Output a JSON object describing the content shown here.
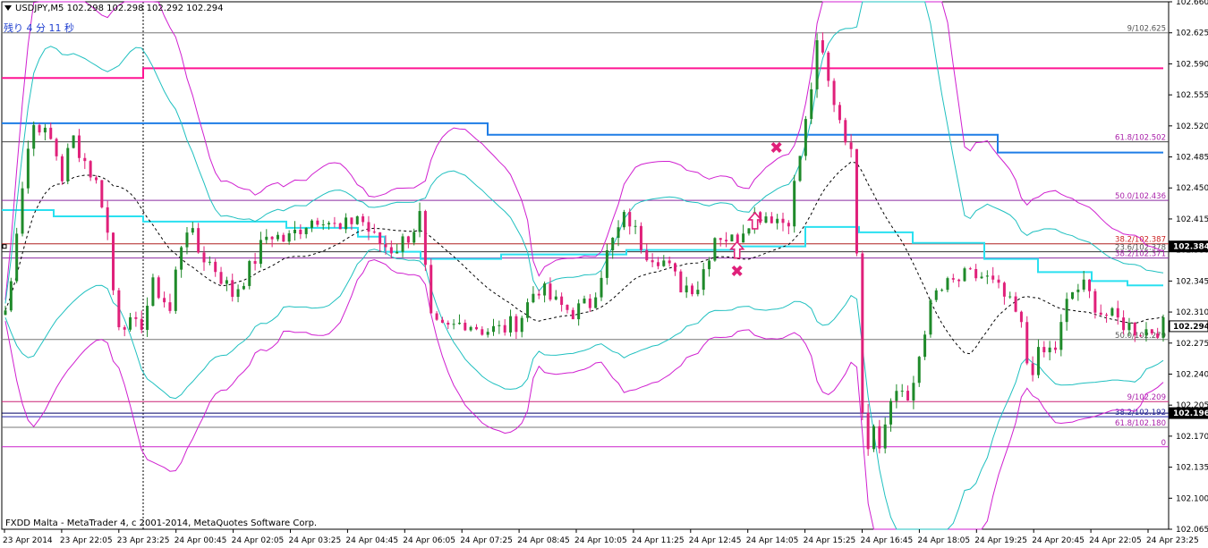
{
  "header": {
    "dropdown_icon": "triangle-down",
    "symbol_line": "USDJPY,M5  102.298 102.298 102.292 102.294",
    "timer": "残り 4 分 11 秒"
  },
  "footer": {
    "copyright": "FXDD Malta - MetaTrader 4, c 2001-2014, MetaQuotes Software Corp."
  },
  "chart_data": {
    "type": "candlestick",
    "symbol": "USDJPY",
    "timeframe": "M5",
    "ylim": [
      102.065,
      102.66
    ],
    "y_ticks": [
      "102.660",
      "102.625",
      "102.590",
      "102.555",
      "102.520",
      "102.485",
      "102.450",
      "102.415",
      "102.380",
      "102.345",
      "102.310",
      "102.275",
      "102.240",
      "102.205",
      "102.170",
      "102.135",
      "102.100",
      "102.065"
    ],
    "x_ticks": [
      "23 Apr 2014",
      "23 Apr 22:05",
      "23 Apr 23:25",
      "24 Apr 00:45",
      "24 Apr 02:05",
      "24 Apr 03:25",
      "24 Apr 04:45",
      "24 Apr 06:05",
      "24 Apr 07:25",
      "24 Apr 08:45",
      "24 Apr 10:05",
      "24 Apr 11:25",
      "24 Apr 12:45",
      "24 Apr 14:05",
      "24 Apr 15:25",
      "24 Apr 16:45",
      "24 Apr 18:05",
      "24 Apr 19:25",
      "24 Apr 20:45",
      "24 Apr 22:05",
      "24 Apr 23:25"
    ],
    "current_price": "102.294",
    "price_tags": [
      {
        "value": 102.384,
        "label": "102.384"
      },
      {
        "value": 102.294,
        "label": "102.294"
      },
      {
        "value": 102.196,
        "label": "102.196"
      }
    ],
    "fib_levels": [
      {
        "value": 102.625,
        "label": "9/102.625",
        "color": "#555555"
      },
      {
        "value": 102.502,
        "label": "61.8/102.502",
        "color": "#aa22aa"
      },
      {
        "value": 102.436,
        "label": "50.0/102.436",
        "color": "#aa22aa"
      },
      {
        "value": 102.387,
        "label": "38.2/102.387",
        "color": "#cc2222"
      },
      {
        "value": 102.378,
        "label": "23.6/102.378",
        "color": "#555555"
      },
      {
        "value": 102.371,
        "label": "38.2/102.371",
        "color": "#aa22aa"
      },
      {
        "value": 102.279,
        "label": "50.0/102.279",
        "color": "#555555"
      },
      {
        "value": 102.209,
        "label": "9/102.209",
        "color": "#aa22aa"
      },
      {
        "value": 102.192,
        "label": "38.2/102.192",
        "color": "#222299"
      },
      {
        "value": 102.18,
        "label": "61.8/102.180",
        "color": "#aa22aa"
      },
      {
        "value": 102.158,
        "label": "0",
        "color": "#aa22aa"
      }
    ],
    "horizontal_lines": [
      {
        "value": 102.625,
        "color": "#777777"
      },
      {
        "value": 102.502,
        "color": "#444444"
      },
      {
        "value": 102.436,
        "color": "#8a2aa0"
      },
      {
        "value": 102.387,
        "color": "#b02020"
      },
      {
        "value": 102.378,
        "color": "#333333"
      },
      {
        "value": 102.371,
        "color": "#8a2aa0"
      },
      {
        "value": 102.279,
        "color": "#777777"
      },
      {
        "value": 102.209,
        "color": "#cc2277"
      },
      {
        "value": 102.196,
        "color": "#000066"
      },
      {
        "value": 102.192,
        "color": "#2222aa"
      },
      {
        "value": 102.18,
        "color": "#777777"
      },
      {
        "value": 102.158,
        "color": "#cc22cc"
      }
    ],
    "markers": [
      {
        "type": "cross",
        "color": "#e0207a",
        "x": "24 Apr 14:45",
        "y": 102.495
      },
      {
        "type": "cross",
        "color": "#e0207a",
        "x": "24 Apr 13:50",
        "y": 102.356
      },
      {
        "type": "arrow-up",
        "color": "#e0207a",
        "x": "24 Apr 13:50",
        "y": 102.381
      },
      {
        "type": "arrow-up",
        "color": "#e0207a",
        "x": "24 Apr 14:15",
        "y": 102.414
      }
    ],
    "colors": {
      "bull": "#1f8a2a",
      "bear": "#e0207a",
      "bollinger_outer": "#d020d0",
      "bollinger_inner": "#20c0c0",
      "mid_band": "#000000",
      "stepline_blue": "#1e7de6",
      "stepline_cyan": "#2ae0f0",
      "stepline_magenta": "#ff1493"
    }
  }
}
